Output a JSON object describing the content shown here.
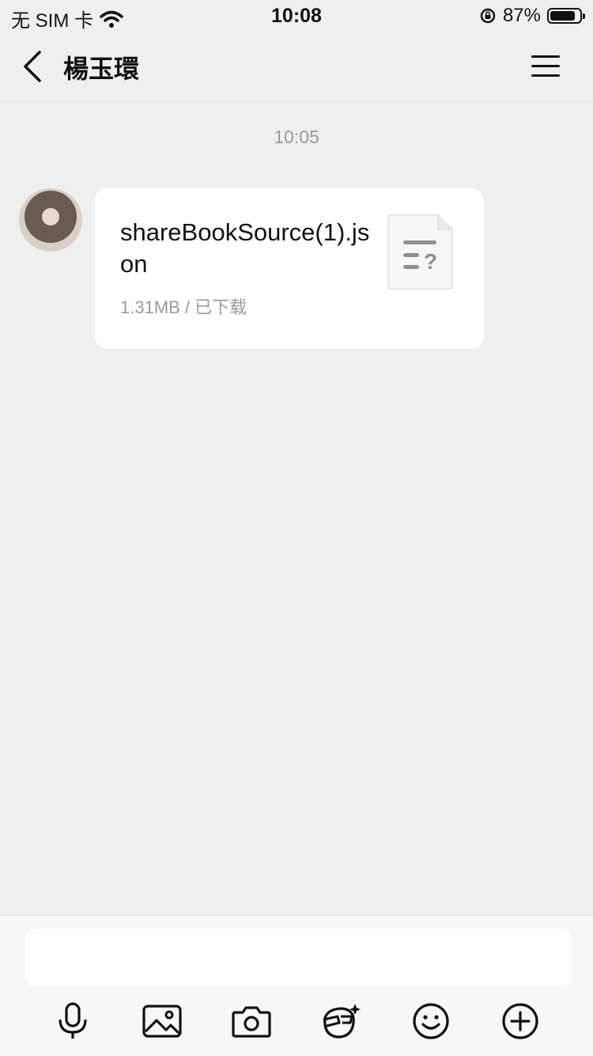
{
  "status_bar": {
    "carrier": "无 SIM 卡",
    "time": "10:08",
    "battery": "87%",
    "battery_level": 0.87
  },
  "nav": {
    "title": "楊玉環"
  },
  "chat": {
    "timestamp": "10:05",
    "message": {
      "file_name": "shareBookSource(1).json",
      "file_meta": "1.31MB / 已下载"
    }
  },
  "input": {
    "placeholder": ""
  },
  "toolbar_icons": [
    "microphone-icon",
    "image-icon",
    "camera-icon",
    "sticker-icon",
    "emoji-icon",
    "plus-icon"
  ]
}
